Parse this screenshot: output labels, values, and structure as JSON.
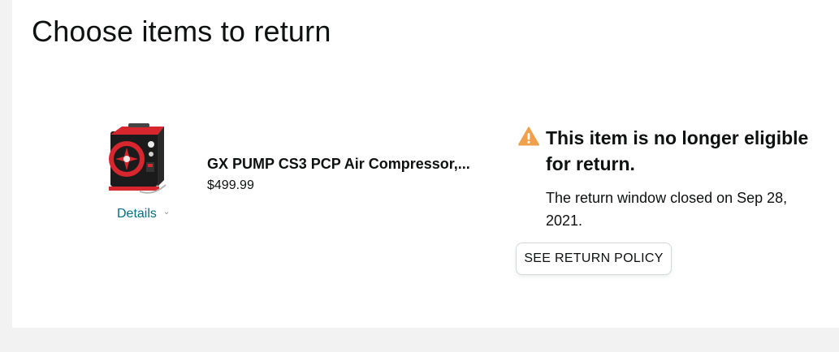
{
  "page": {
    "title": "Choose items to return"
  },
  "item": {
    "name": "GX PUMP CS3 PCP Air Compressor,...",
    "price": "$499.99",
    "details_label": "Details",
    "image_icon": "air-compressor-product-image",
    "details_icon": "chevron-down-icon"
  },
  "eligibility": {
    "icon": "warning-icon",
    "heading": "This item is no longer eligible for return.",
    "message": "The return window closed on Sep 28, 2021.",
    "policy_button_label": "SEE RETURN POLICY"
  },
  "colors": {
    "background": "#f2f2f2",
    "card": "#ffffff",
    "link": "#007185",
    "warning": "#f0a04b",
    "text": "#0f1111",
    "product_red": "#d7262e",
    "product_body": "#1b1b1b"
  }
}
